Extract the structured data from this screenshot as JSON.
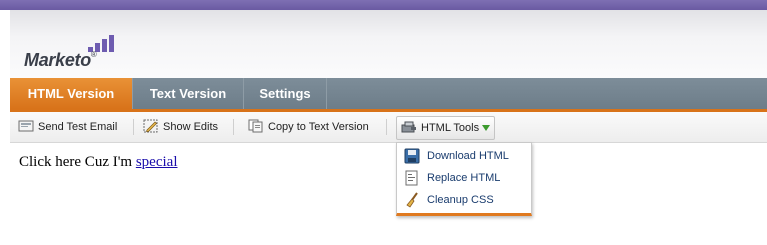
{
  "app": {
    "logo_text": "Marketo",
    "logo_mark": "®",
    "brand_color": "#6e5cb0",
    "accent_color": "#d8731a"
  },
  "tabs": [
    {
      "label": "HTML Version",
      "active": true
    },
    {
      "label": "Text Version",
      "active": false
    },
    {
      "label": "Settings",
      "active": false
    }
  ],
  "toolbar": {
    "send_test_email": {
      "label": "Send Test Email",
      "icon": "email-icon"
    },
    "show_edits": {
      "label": "Show Edits",
      "icon": "pencil-icon"
    },
    "copy_to_text": {
      "label": "Copy to Text Version",
      "icon": "copy-icon"
    },
    "html_tools": {
      "label": "HTML Tools",
      "icon": "tools-icon"
    }
  },
  "menu": {
    "items": [
      {
        "label": "Download HTML",
        "icon": "save-disk-icon"
      },
      {
        "label": "Replace HTML",
        "icon": "document-icon"
      },
      {
        "label": "Cleanup CSS",
        "icon": "broom-icon"
      }
    ]
  },
  "content": {
    "text": "Click here Cuz I'm ",
    "link_text": "special"
  }
}
